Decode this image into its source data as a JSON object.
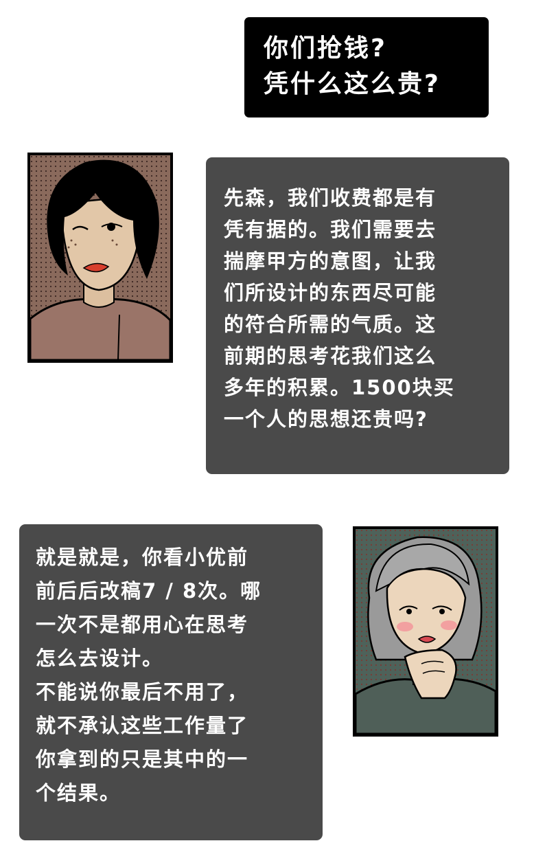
{
  "top_bubble": {
    "text": "你们抢钱?\n凭什么这么贵?"
  },
  "middle_bubble": {
    "text": "先森，我们收费都是有\n凭有据的。我们需要去\n揣摩甲方的意图，让我\n们所设计的东西尽可能\n的符合所需的气质。这\n前期的思考花我们这么\n多年的积累。1500块买\n一个人的思想还贵吗?"
  },
  "bottom_bubble": {
    "text": "就是就是，你看小优前\n前后后改稿7 / 8次。哪\n一次不是都用心在思考\n怎么去设计。\n不能说你最后不用了，\n就不承认这些工作量了\n你拿到的只是其中的一\n个结果。"
  },
  "colors": {
    "dark_bubble": "#000000",
    "gray_bubble": "#4a4a4a",
    "portrait_a_bg": "#8a6a5c",
    "portrait_b_bg": "#4e625a"
  },
  "illustrations": [
    "woman-black-bob-portrait",
    "woman-gray-hair-hand-on-chin-portrait"
  ]
}
